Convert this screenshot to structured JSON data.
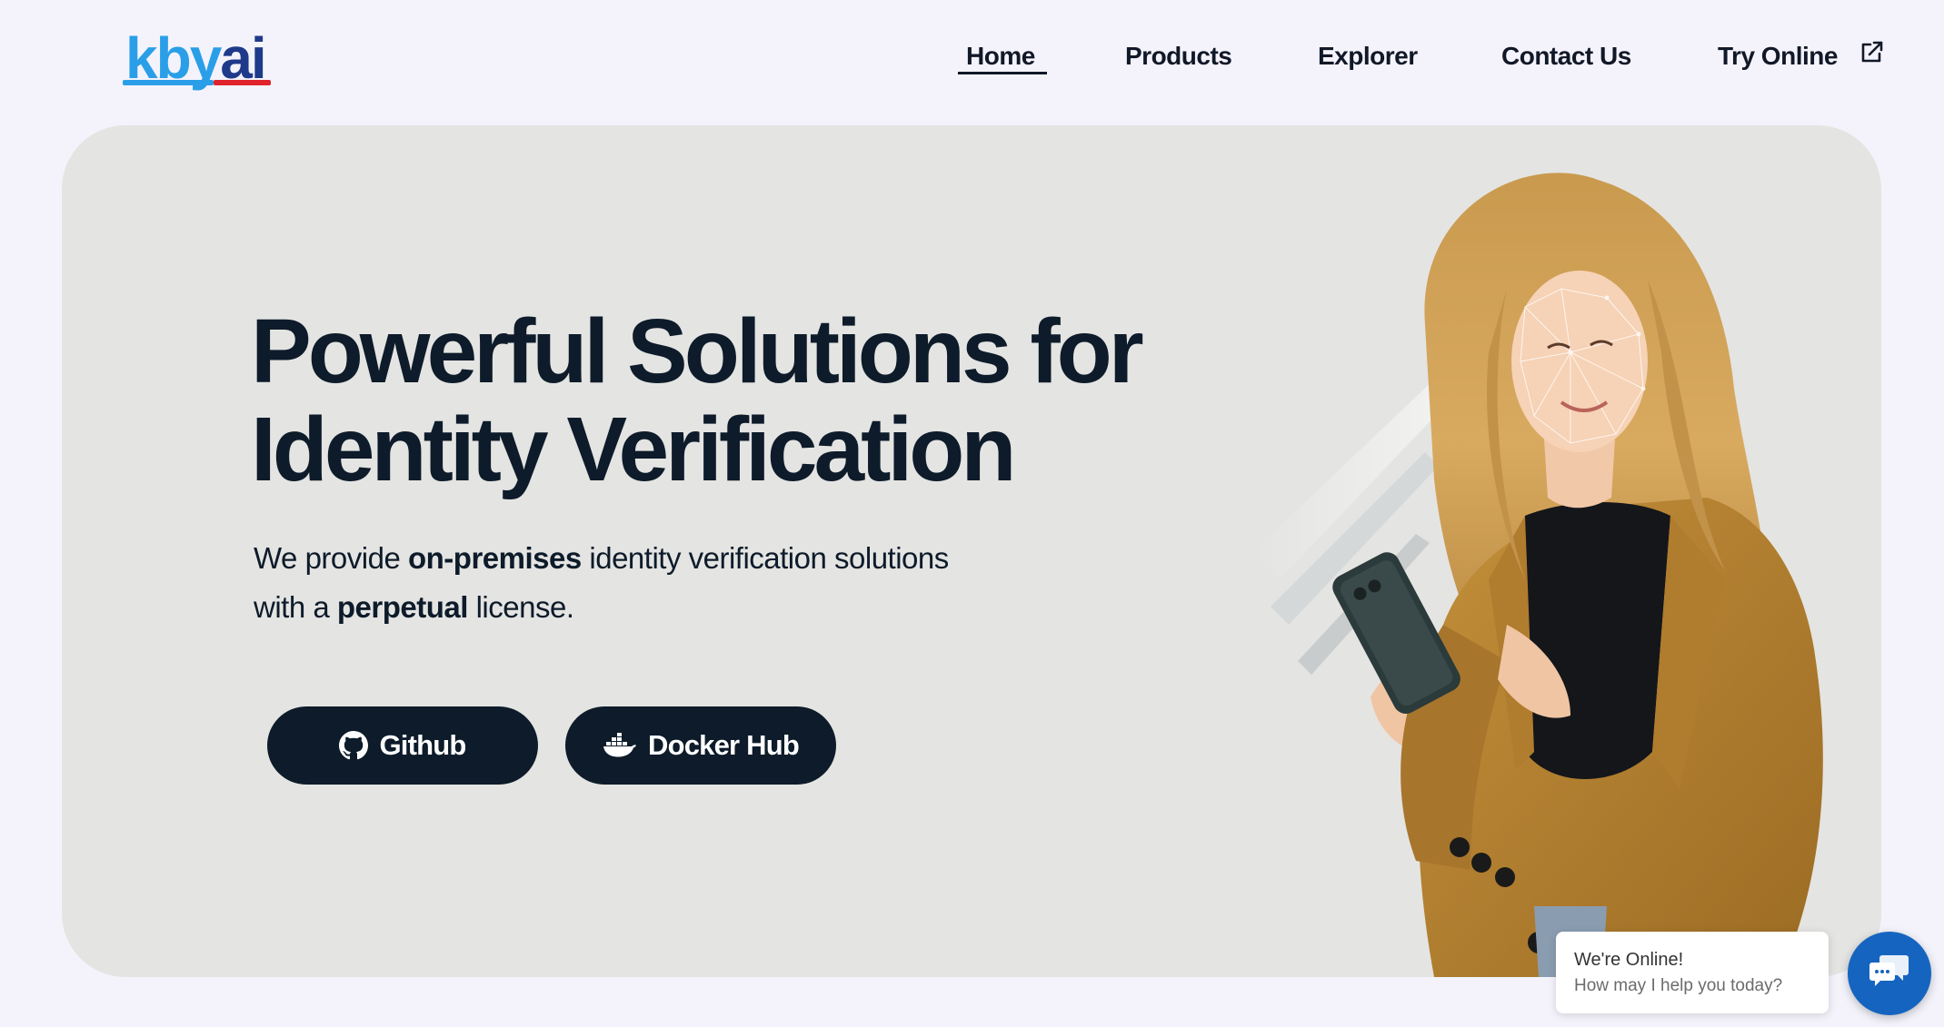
{
  "header": {
    "logo": {
      "kby": "kby",
      "ai": "ai"
    },
    "nav": {
      "home": "Home",
      "products": "Products",
      "explorer": "Explorer",
      "contact": "Contact Us",
      "try_online": "Try Online"
    }
  },
  "hero": {
    "title_line1": "Powerful Solutions for",
    "title_line2": "Identity Verification",
    "subtitle": {
      "part1": "We provide ",
      "bold1": "on-premises",
      "part2": " identity verification solutions",
      "part3": "with a ",
      "bold2": "perpetual",
      "part4": " license."
    },
    "buttons": {
      "github": "Github",
      "docker": "Docker Hub"
    }
  },
  "chat": {
    "status": "We're Online!",
    "prompt": "How may I help you today?"
  },
  "colors": {
    "background": "#f4f3fb",
    "hero_bg": "#e4e4e2",
    "primary_dark": "#0d1b2a",
    "logo_blue": "#2a9fe8",
    "logo_navy": "#1f3a8a",
    "logo_red": "#e0222b",
    "chat_blue": "#1565c0"
  },
  "icons": [
    "external-link-icon",
    "github-icon",
    "docker-icon",
    "chat-icon"
  ]
}
